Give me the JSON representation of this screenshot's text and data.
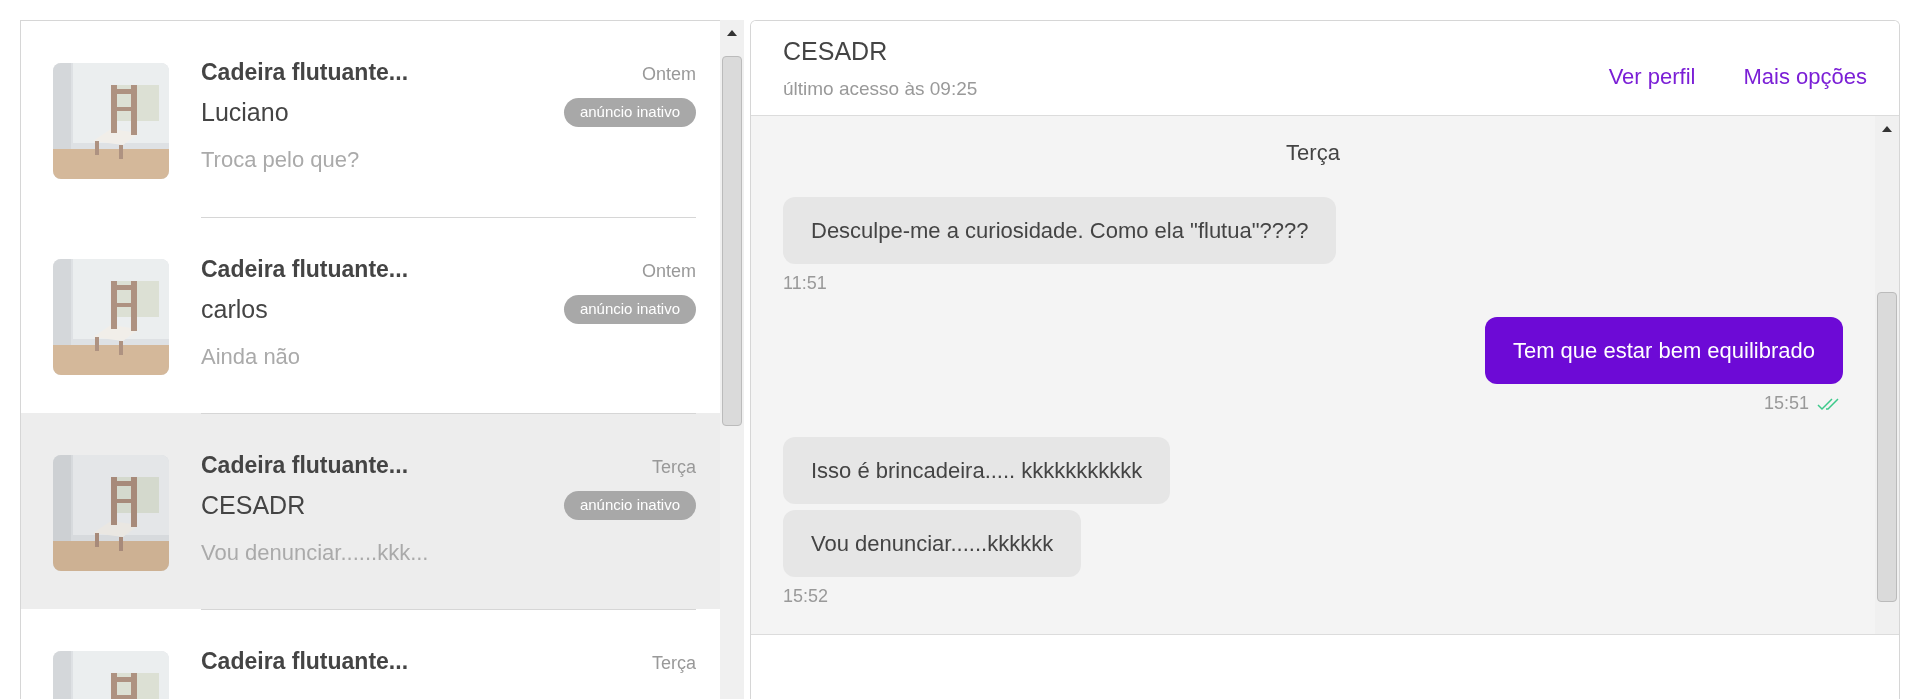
{
  "conversations": [
    {
      "title": "Cadeira flutuante...",
      "name": "Luciano",
      "last_message": "Troca pelo que?",
      "date": "Ontem",
      "badge": "anúncio inativo",
      "selected": false
    },
    {
      "title": "Cadeira flutuante...",
      "name": "carlos",
      "last_message": "Ainda não",
      "date": "Ontem",
      "badge": "anúncio inativo",
      "selected": false
    },
    {
      "title": "Cadeira flutuante...",
      "name": "CESADR",
      "last_message": "Vou denunciar......kkk...",
      "date": "Terça",
      "badge": "anúncio inativo",
      "selected": true
    },
    {
      "title": "Cadeira flutuante...",
      "date": "Terça",
      "selected": false
    }
  ],
  "chat": {
    "contact": "CESADR",
    "last_seen": "último acesso às 09:25",
    "actions": [
      "Ver perfil",
      "Mais opções"
    ],
    "day": "Terça",
    "groups": [
      {
        "kind": "received",
        "messages": [
          "Desculpe-me a curiosidade. Como ela \"flutua\"????"
        ],
        "time": "11:51"
      },
      {
        "kind": "sent",
        "messages": [
          "Tem que estar bem equilibrado"
        ],
        "time": "15:51",
        "read": true
      },
      {
        "kind": "received",
        "messages": [
          "Isso é brincadeira..... kkkkkkkkkkk",
          "Vou denunciar......kkkkkk"
        ],
        "time": "15:52"
      }
    ]
  }
}
